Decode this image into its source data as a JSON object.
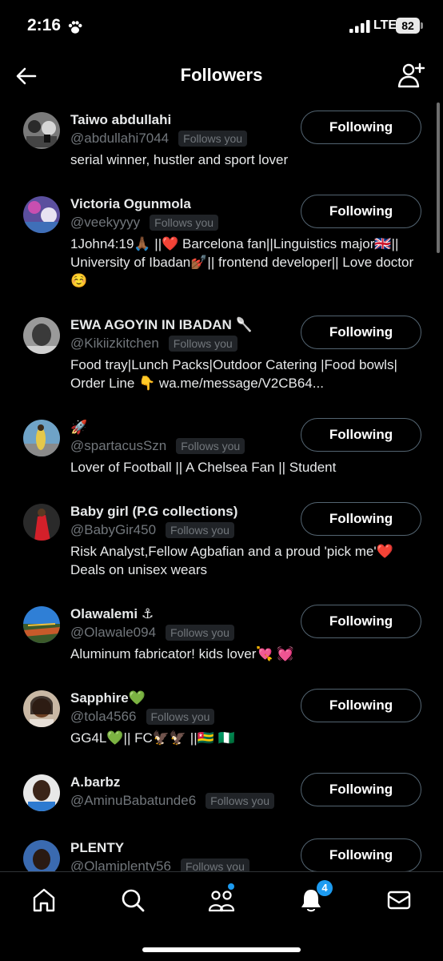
{
  "status_bar": {
    "time": "2:16",
    "network": "LTE",
    "battery": "82"
  },
  "header": {
    "title": "Followers",
    "back_icon": "arrow-left-icon",
    "add_icon": "add-user-icon"
  },
  "followers": [
    {
      "name": "Taiwo abdullahi",
      "handle": "@abdullahi7044",
      "follows_label": "Follows you",
      "bio": "serial winner, hustler and sport lover",
      "button": "Following"
    },
    {
      "name": "Victoria Ogunmola",
      "handle": "@veekyyyy",
      "follows_label": "Follows you",
      "bio": "1John4:19🙏🏾 ||❤️ Barcelona fan||Linguistics major🇬🇧|| University of Ibadan💅🏾|| frontend developer|| Love doctor☺️",
      "button": "Following"
    },
    {
      "name": "EWA AGOYIN IN IBADAN 🥄",
      "handle": "@Kikiizkitchen",
      "follows_label": "Follows you",
      "bio": "Food tray|Lunch Packs|Outdoor Catering |Food bowls| Order Line 👇 wa.me/message/V2CB64...",
      "button": "Following"
    },
    {
      "name": "🚀",
      "handle": "@spartacusSzn",
      "follows_label": "Follows you",
      "bio": "Lover of Football || A Chelsea Fan || Student",
      "button": "Following"
    },
    {
      "name": "Baby girl (P.G collections)",
      "handle": "@BabyGir450",
      "follows_label": "Follows you",
      "bio": "Risk Analyst,Fellow Agbafian and a proud 'pick me'❤️ Deals on unisex wears",
      "button": "Following"
    },
    {
      "name": "Olawalemi ⚓",
      "handle": "@Olawale094",
      "follows_label": "Follows you",
      "bio": "Aluminum fabricator! kids lover💘 💓",
      "button": "Following"
    },
    {
      "name": "Sapphire💚",
      "handle": "@tola4566",
      "follows_label": "Follows you",
      "bio": "GG4L💚|| FC🦅🦅 ||🇹🇬 🇳🇬",
      "button": "Following"
    },
    {
      "name": "A.barbz",
      "handle": "@AminuBabatunde6",
      "follows_label": "Follows you",
      "bio": "",
      "button": "Following"
    },
    {
      "name": "PLENTY",
      "handle": "@Olamiplenty56",
      "follows_label": "Follows you",
      "bio": "",
      "button": "Following"
    }
  ],
  "bottom_nav": {
    "items": [
      "home-icon",
      "search-icon",
      "communities-icon",
      "notifications-icon",
      "messages-icon"
    ],
    "notifications_badge": "4"
  },
  "colors": {
    "background": "#000000",
    "text": "#e7e9ea",
    "muted": "#71767b",
    "accent": "#1d9bf0"
  }
}
